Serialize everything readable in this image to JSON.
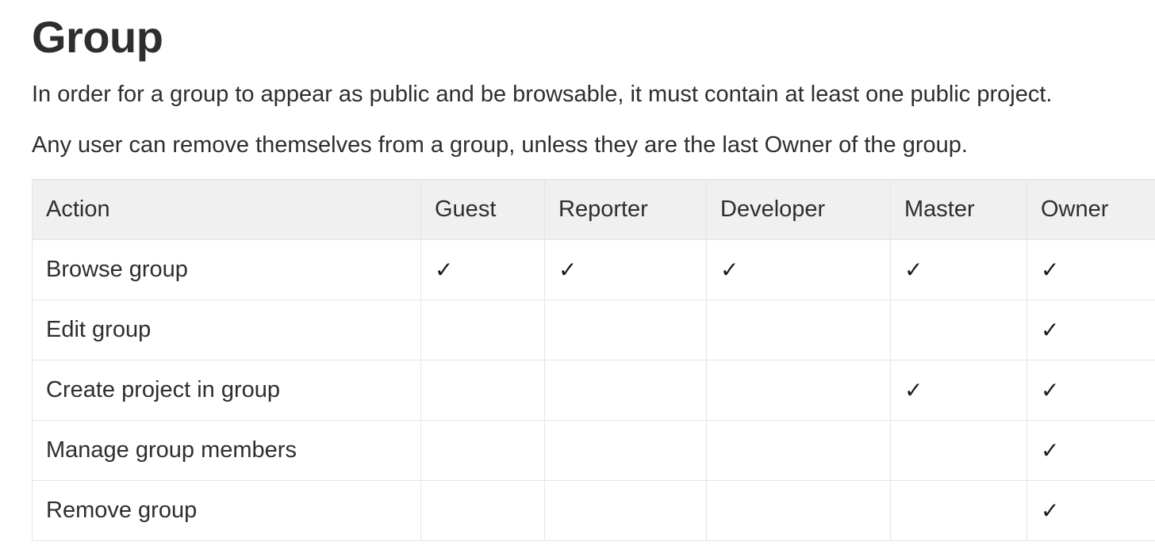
{
  "title": "Group",
  "paragraphs": [
    "In order for a group to appear as public and be browsable, it must contain at least one public project.",
    "Any user can remove themselves from a group, unless they are the last Owner of the group."
  ],
  "check_mark": "✓",
  "table": {
    "headers": [
      "Action",
      "Guest",
      "Reporter",
      "Developer",
      "Master",
      "Owner"
    ],
    "rows": [
      {
        "action": "Browse group",
        "guest": "✓",
        "reporter": "✓",
        "developer": "✓",
        "master": "✓",
        "owner": "✓"
      },
      {
        "action": "Edit group",
        "guest": "",
        "reporter": "",
        "developer": "",
        "master": "",
        "owner": "✓"
      },
      {
        "action": "Create project in group",
        "guest": "",
        "reporter": "",
        "developer": "",
        "master": "✓",
        "owner": "✓"
      },
      {
        "action": "Manage group members",
        "guest": "",
        "reporter": "",
        "developer": "",
        "master": "",
        "owner": "✓"
      },
      {
        "action": "Remove group",
        "guest": "",
        "reporter": "",
        "developer": "",
        "master": "",
        "owner": "✓"
      }
    ]
  }
}
